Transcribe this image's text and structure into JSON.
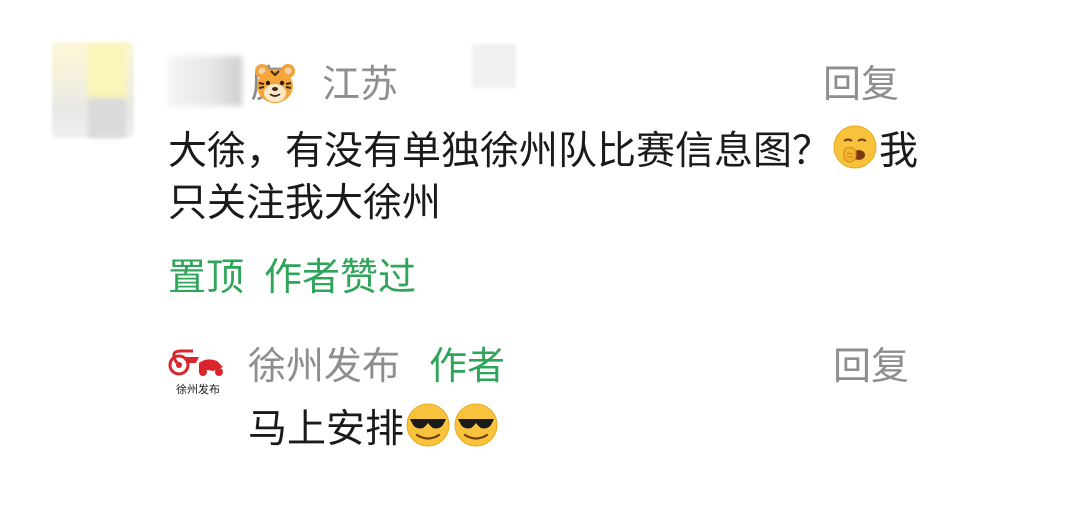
{
  "comment": {
    "username_visible": "虎",
    "location": "江苏",
    "reply_label": "回复",
    "text_line1_a": "大徐，有没有单独徐州队比赛信息图？",
    "text_line1_b": "我",
    "text_line2": "只关注我大徐州",
    "emoji_icon": "yawning-face-icon",
    "tag_pinned": "置顶",
    "tag_author_liked": "作者赞过"
  },
  "reply": {
    "author_name": "徐州发布",
    "author_badge": "作者",
    "reply_label": "回复",
    "text": "马上安排",
    "emoji_icon": "sunglasses-face-icon",
    "logo_text": "徐州发布"
  },
  "colors": {
    "accent_green": "#2fa55a",
    "meta_gray": "#8e8e8e",
    "text_dark": "#1a1a1a",
    "logo_red": "#d9252b"
  }
}
